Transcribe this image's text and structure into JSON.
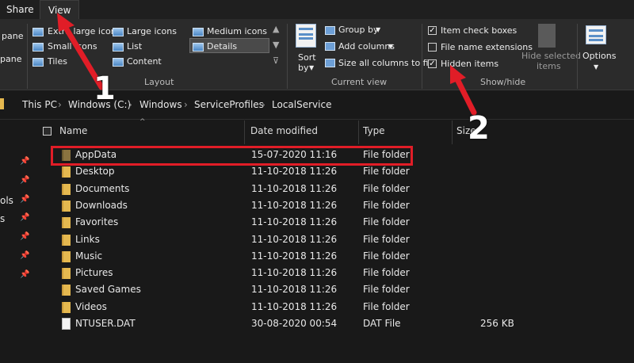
{
  "tabs": {
    "share": "Share",
    "view": "View"
  },
  "ribbon": {
    "panes": {
      "item1": "pane",
      "item2": "pane"
    },
    "layout": {
      "extra_large": "Extra large icons",
      "large": "Large icons",
      "medium": "Medium icons",
      "small": "Small icons",
      "list": "List",
      "details": "Details",
      "tiles": "Tiles",
      "content": "Content",
      "group_label": "Layout"
    },
    "current_view": {
      "sort_by": "Sort",
      "sort_by_2": "by",
      "group_by": "Group by",
      "add_columns": "Add columns",
      "size_all": "Size all columns to fit",
      "group_label": "Current view"
    },
    "show_hide": {
      "item_check_boxes": "Item check boxes",
      "file_name_extensions": "File name extensions",
      "hidden_items": "Hidden items",
      "hide_selected": "Hide selected",
      "hide_selected_2": "items",
      "group_label": "Show/hide"
    },
    "options": "Options"
  },
  "breadcrumb": [
    "This PC",
    "Windows (C:)",
    "Windows",
    "ServiceProfiles",
    "LocalService"
  ],
  "sidebar_fragments": {
    "ols": "ols",
    "s": "s"
  },
  "columns": {
    "name": "Name",
    "date": "Date modified",
    "type": "Type",
    "size": "Size"
  },
  "files": [
    {
      "name": "AppData",
      "date": "15-07-2020 11:16",
      "type": "File folder",
      "size": ""
    },
    {
      "name": "Desktop",
      "date": "11-10-2018 11:26",
      "type": "File folder",
      "size": ""
    },
    {
      "name": "Documents",
      "date": "11-10-2018 11:26",
      "type": "File folder",
      "size": ""
    },
    {
      "name": "Downloads",
      "date": "11-10-2018 11:26",
      "type": "File folder",
      "size": ""
    },
    {
      "name": "Favorites",
      "date": "11-10-2018 11:26",
      "type": "File folder",
      "size": ""
    },
    {
      "name": "Links",
      "date": "11-10-2018 11:26",
      "type": "File folder",
      "size": ""
    },
    {
      "name": "Music",
      "date": "11-10-2018 11:26",
      "type": "File folder",
      "size": ""
    },
    {
      "name": "Pictures",
      "date": "11-10-2018 11:26",
      "type": "File folder",
      "size": ""
    },
    {
      "name": "Saved Games",
      "date": "11-10-2018 11:26",
      "type": "File folder",
      "size": ""
    },
    {
      "name": "Videos",
      "date": "11-10-2018 11:26",
      "type": "File folder",
      "size": ""
    },
    {
      "name": "NTUSER.DAT",
      "date": "30-08-2020 00:54",
      "type": "DAT File",
      "size": "256 KB"
    }
  ],
  "annotations": {
    "step1": "1",
    "step2": "2"
  },
  "colors": {
    "annotation_red": "#e11d27",
    "folder_yellow": "#e5b84f",
    "background": "#191919",
    "ribbon": "#2b2b2b"
  }
}
